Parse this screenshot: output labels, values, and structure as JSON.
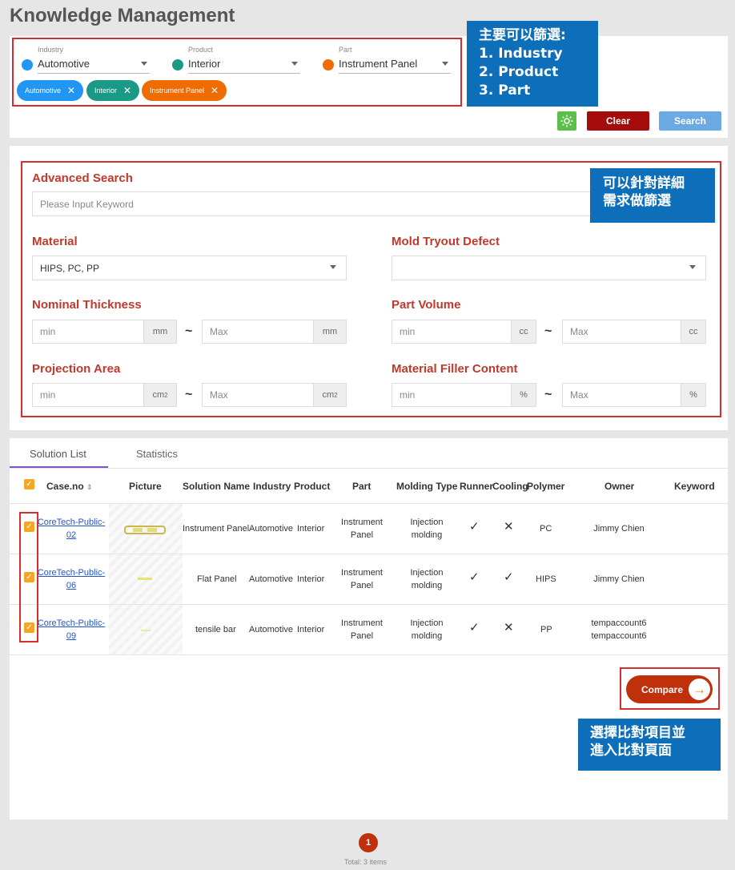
{
  "page_title": "Knowledge Management",
  "filters": {
    "industry": {
      "label": "Industry",
      "value": "Automotive",
      "color": "#2196f3"
    },
    "product": {
      "label": "Product",
      "value": "Interior",
      "color": "#1a9a86"
    },
    "part": {
      "label": "Part",
      "value": "Instrument Panel",
      "color": "#ef6c00"
    },
    "chips": [
      {
        "label": "Automotive",
        "color": "#2196f3"
      },
      {
        "label": "Interior",
        "color": "#1a9a86"
      },
      {
        "label": "Instrument Panel",
        "color": "#ef6c00"
      }
    ],
    "clear_label": "Clear",
    "search_label": "Search",
    "settings_icon": "gear-icon"
  },
  "callouts": {
    "filters": [
      "主要可以篩選:",
      "1. Industry",
      "2. Product",
      "3. Part"
    ],
    "advanced": [
      "可以針對詳細",
      "需求做篩選"
    ],
    "compare": [
      "選擇比對項目並",
      "進入比對頁面"
    ]
  },
  "advanced": {
    "title": "Advanced Search",
    "keyword_placeholder": "Please Input Keyword",
    "material_label": "Material",
    "material_value": "HIPS, PC, PP",
    "defect_label": "Mold Tryout Defect",
    "defect_value": "",
    "thickness_label": "Nominal Thickness",
    "thickness_min": "min",
    "thickness_max": "Max",
    "thickness_unit": "mm",
    "volume_label": "Part Volume",
    "volume_min": "min",
    "volume_max": "Max",
    "volume_unit": "cc",
    "projection_label": "Projection Area",
    "projection_min": "min",
    "projection_max": "Max",
    "projection_unit": "cm",
    "projection_unit_sup": "2",
    "filler_label": "Material Filler Content",
    "filler_min": "min",
    "filler_max": "Max",
    "filler_unit": "%",
    "range_sep": "~"
  },
  "tabs": [
    "Solution List",
    "Statistics"
  ],
  "table": {
    "headers": [
      "Case.no",
      "Picture",
      "Solution Name",
      "Industry",
      "Product",
      "Part",
      "Molding Type",
      "Runner",
      "Cooling",
      "Polymer",
      "Owner",
      "Keyword"
    ],
    "rows": [
      {
        "case_a": "CoreTech-Public-",
        "case_b": "02",
        "solution": "Instrument Panel",
        "industry": "Automotive",
        "product": "Interior",
        "part_a": "Instrument",
        "part_b": "Panel",
        "mold_a": "Injection",
        "mold_b": "molding",
        "runner": "✓",
        "cooling": "✕",
        "polymer": "PC",
        "owner_a": "Jimmy Chien",
        "owner_b": "",
        "keyword": ""
      },
      {
        "case_a": "CoreTech-Public-",
        "case_b": "06",
        "solution": "Flat Panel",
        "industry": "Automotive",
        "product": "Interior",
        "part_a": "Instrument",
        "part_b": "Panel",
        "mold_a": "Injection",
        "mold_b": "molding",
        "runner": "✓",
        "cooling": "✓",
        "polymer": "HIPS",
        "owner_a": "Jimmy Chien",
        "owner_b": "",
        "keyword": ""
      },
      {
        "case_a": "CoreTech-Public-",
        "case_b": "09",
        "solution": "tensile bar",
        "industry": "Automotive",
        "product": "Interior",
        "part_a": "Instrument",
        "part_b": "Panel",
        "mold_a": "Injection",
        "mold_b": "molding",
        "runner": "✓",
        "cooling": "✕",
        "polymer": "PP",
        "owner_a": "tempaccount6",
        "owner_b": "tempaccount6",
        "keyword": ""
      }
    ]
  },
  "compare_label": "Compare",
  "pagination": {
    "page": "1",
    "total": "Total: 3 items"
  }
}
